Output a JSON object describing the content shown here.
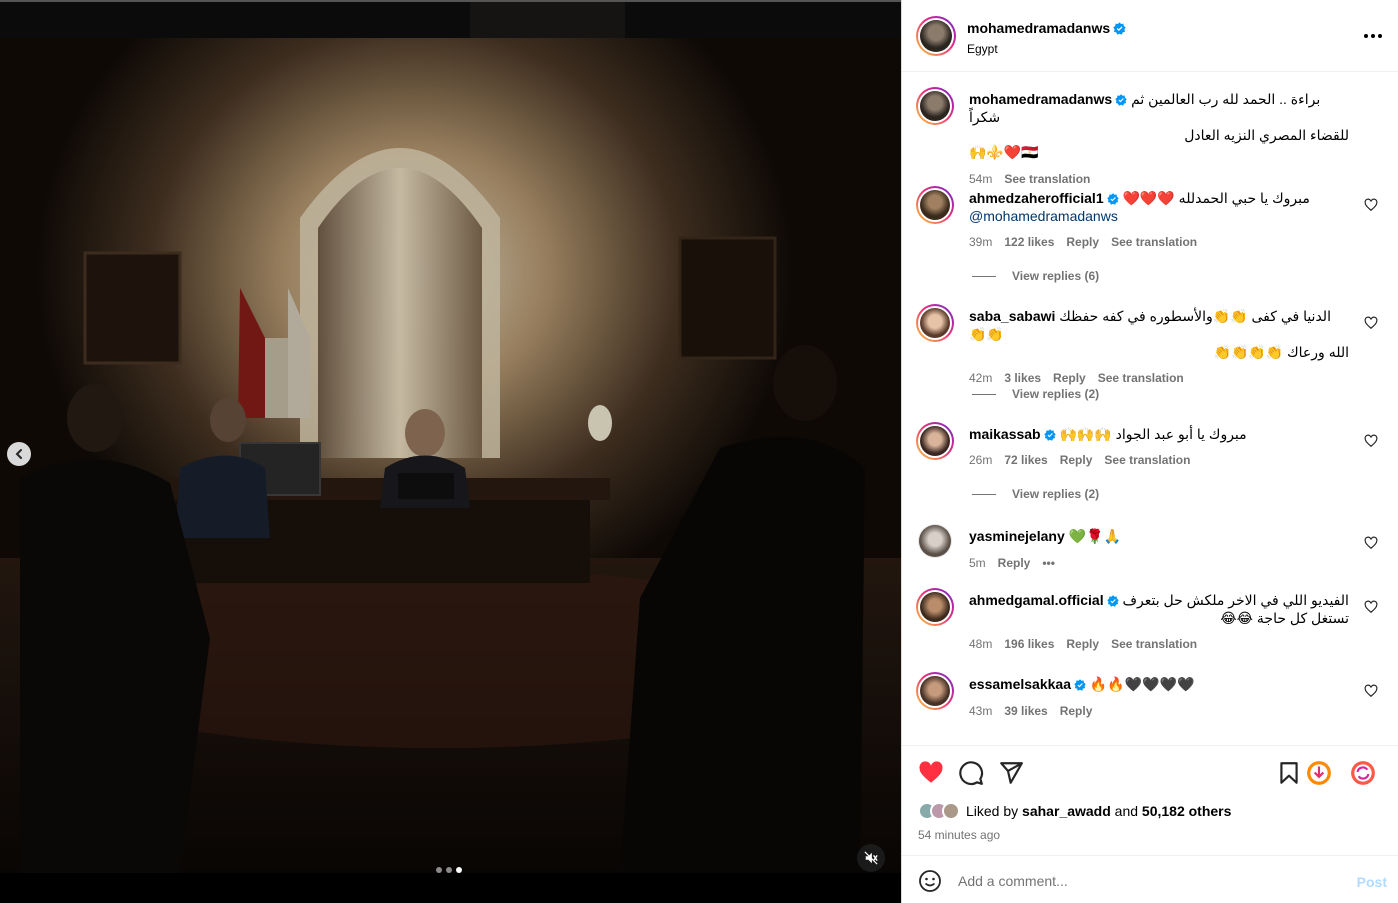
{
  "post": {
    "author": "mohamedramadanws",
    "location": "Egypt"
  },
  "caption": {
    "username": "mohamedramadanws",
    "text_line1": "براءة .. الحمد لله رب العالمين ثم شكراً",
    "text_line2": "للقضاء المصري النزيه العادل",
    "text_line3": "🙌⚜️❤️🇪🇬",
    "time": "54m",
    "see_translation": "See translation"
  },
  "comments": [
    {
      "username": "ahmedzaherofficial1",
      "text": "مبروك يا حبي الحمدلله ❤️❤️❤️",
      "text2": "@mohamedramadanws",
      "time": "39m",
      "likes": "122 likes",
      "reply": "Reply",
      "see_translation": "See translation",
      "view_replies": "View replies (6)"
    },
    {
      "username": "saba_sabawi",
      "text": "الدنيا في كفى 👏👏والأسطوره في كفه حفظك 👏👏",
      "text2": "الله ورعاك 👏👏👏👏",
      "time": "42m",
      "likes": "3 likes",
      "reply": "Reply",
      "see_translation": "See translation",
      "view_replies": "View replies (2)"
    },
    {
      "username": "maikassab",
      "text": "مبروك يا أبو عبد الجواد 🙌🙌🙌",
      "time": "26m",
      "likes": "72 likes",
      "reply": "Reply",
      "see_translation": "See translation",
      "view_replies": "View replies (2)"
    },
    {
      "username": "yasminejelany",
      "text": "💚🌹🙏",
      "time": "5m",
      "reply": "Reply",
      "more": "•••"
    },
    {
      "username": "ahmedgamal.official",
      "text": "الفيديو اللي في الاخر ملكش حل بتعرف",
      "text2": "تستغل كل حاجة 😂😂",
      "time": "48m",
      "likes": "196 likes",
      "reply": "Reply",
      "see_translation": "See translation"
    },
    {
      "username": "essamelsakkaa",
      "text": "🔥🔥🖤🖤🖤🖤",
      "time": "43m",
      "likes": "39 likes",
      "reply": "Reply"
    }
  ],
  "likes": {
    "liked_by_prefix": "Liked by",
    "liked_by_user": "sahar_awadd",
    "and": "and",
    "others": "50,182 others",
    "time_ago": "54 minutes ago"
  },
  "add_comment": {
    "placeholder": "Add a comment...",
    "post_label": "Post"
  },
  "colors": {
    "heart_red": "#ff3040",
    "verified_blue": "#0095f6",
    "link_blue": "#00376b",
    "muted": "#737373",
    "post_disabled": "#b3dbff"
  },
  "icons": {
    "like": "heart-filled-icon",
    "comment": "comment-bubble-icon",
    "share": "paper-plane-icon",
    "save": "bookmark-icon",
    "more": "more-options-icon",
    "mute": "muted-speaker-icon",
    "prev": "chevron-left-icon",
    "emoji": "smiley-icon"
  },
  "media": {
    "slides": 3,
    "active_slide": 3
  }
}
